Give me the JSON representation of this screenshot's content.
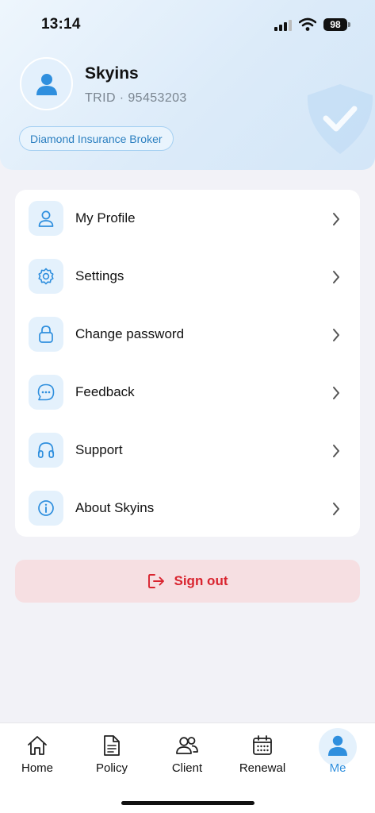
{
  "status_bar": {
    "time": "13:14",
    "battery": "98"
  },
  "profile": {
    "name": "Skyins",
    "trid": "TRID · 95453203",
    "badge": "Diamond Insurance Broker",
    "accent": "#2f8fde"
  },
  "menu": {
    "items": [
      {
        "label": "My Profile",
        "icon": "user-icon"
      },
      {
        "label": "Settings",
        "icon": "gear-icon"
      },
      {
        "label": "Change password",
        "icon": "lock-icon"
      },
      {
        "label": "Feedback",
        "icon": "chat-bubble-icon"
      },
      {
        "label": "Support",
        "icon": "headphones-icon"
      },
      {
        "label": "About Skyins",
        "icon": "info-icon"
      }
    ]
  },
  "signout": {
    "label": "Sign out",
    "color": "#d9242f"
  },
  "tabbar": {
    "tabs": [
      {
        "label": "Home",
        "icon": "home-icon",
        "active": false
      },
      {
        "label": "Policy",
        "icon": "document-icon",
        "active": false
      },
      {
        "label": "Client",
        "icon": "users-icon",
        "active": false
      },
      {
        "label": "Renewal",
        "icon": "calendar-icon",
        "active": false
      },
      {
        "label": "Me",
        "icon": "person-icon",
        "active": true
      }
    ]
  }
}
